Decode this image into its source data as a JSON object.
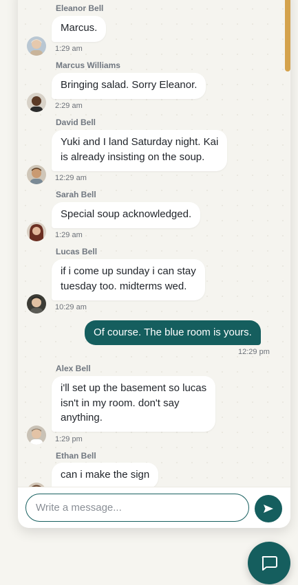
{
  "messages": [
    {
      "sender": "Eleanor Bell",
      "text": "Marcus.",
      "time": "1:29 am",
      "avatar_color": "#c9b49a"
    },
    {
      "sender": "Marcus Williams",
      "text": "Bringing salad. Sorry Eleanor.",
      "time": "2:29 am",
      "avatar_color": "#5b3a26"
    },
    {
      "sender": "David Bell",
      "text": "Yuki and I land Saturday night. Kai\nis already insisting on the soup.",
      "time": "12:29 am",
      "avatar_color": "#a9845f"
    },
    {
      "sender": "Sarah Bell",
      "text": "Special soup acknowledged.",
      "time": "1:29 am",
      "avatar_color": "#8a4a3a"
    },
    {
      "sender": "Lucas Bell",
      "text": "if i come up sunday i can stay\ntuesday too. midterms wed.",
      "time": "10:29 am",
      "avatar_color": "#4a4a44"
    },
    {
      "sender": "Alex Bell",
      "text": "i'll set up the basement so lucas\nisn't in my room. don't say\nanything.",
      "time": "1:29 pm",
      "avatar_color": "#8d7a66"
    },
    {
      "sender": "Ethan Bell",
      "text": "can i make the sign",
      "time": "",
      "avatar_color": "#6b4a34"
    }
  ],
  "outgoing": {
    "text": "Of course. The blue room is yours.",
    "time": "12:29 pm"
  },
  "composer": {
    "placeholder": "Write a message..."
  },
  "colors": {
    "accent": "#155e5e",
    "scrollbar": "#d4a24c"
  },
  "icons": {
    "send": "send-icon",
    "chat": "chat-bubble-icon"
  }
}
